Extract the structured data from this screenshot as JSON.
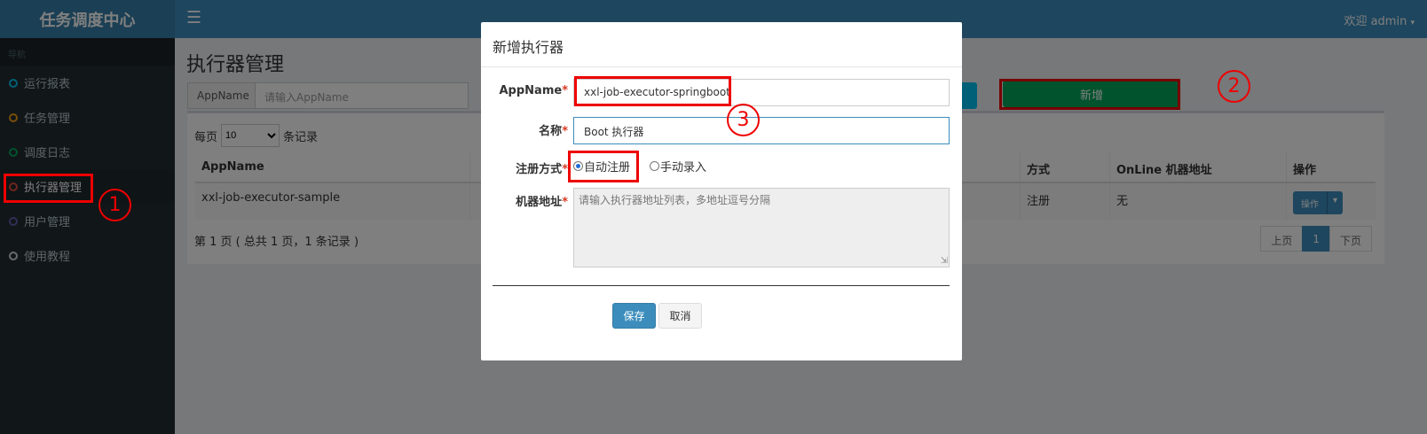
{
  "app": {
    "title": "任务调度中心",
    "welcome": "欢迎 admin"
  },
  "sidebar": {
    "header": "导航",
    "items": [
      {
        "label": "运行报表",
        "color": "#00c0ef"
      },
      {
        "label": "任务管理",
        "color": "#f39c12"
      },
      {
        "label": "调度日志",
        "color": "#00a65a"
      },
      {
        "label": "执行器管理",
        "color": "#dd4b39"
      },
      {
        "label": "用户管理",
        "color": "#605ca8"
      },
      {
        "label": "使用教程",
        "color": "#d2d6de"
      }
    ]
  },
  "page": {
    "title": "执行器管理",
    "filter_label": "AppName",
    "filter_placeholder": "请输入AppName",
    "add_button": "新增",
    "per_page_prefix": "每页",
    "per_page_value": "10",
    "per_page_suffix": "条记录",
    "columns": {
      "appname": "AppName",
      "type": "方式",
      "online": "OnLine 机器地址",
      "ops": "操作"
    },
    "rows": [
      {
        "appname": "xxl-job-executor-sample",
        "type": "注册",
        "online": "无",
        "ops": "操作"
      }
    ],
    "page_info": "第 1 页 ( 总共 1 页，1 条记录 )",
    "pager": {
      "prev": "上页",
      "current": "1",
      "next": "下页"
    }
  },
  "modal": {
    "title": "新增执行器",
    "appname_label": "AppName",
    "appname_value": "xxl-job-executor-springboot",
    "name_label": "名称",
    "name_value": "Boot 执行器",
    "reg_label": "注册方式",
    "reg_auto": "自动注册",
    "reg_manual": "手动录入",
    "addr_label": "机器地址",
    "addr_placeholder": "请输入执行器地址列表，多地址逗号分隔",
    "save": "保存",
    "cancel": "取消",
    "required_mark": "*"
  },
  "annotations": [
    "1",
    "2",
    "3"
  ],
  "colors": {
    "header": "#3c8dbc",
    "sidebar": "#222d32",
    "highlight": "#e00000",
    "success": "#00a65a"
  }
}
